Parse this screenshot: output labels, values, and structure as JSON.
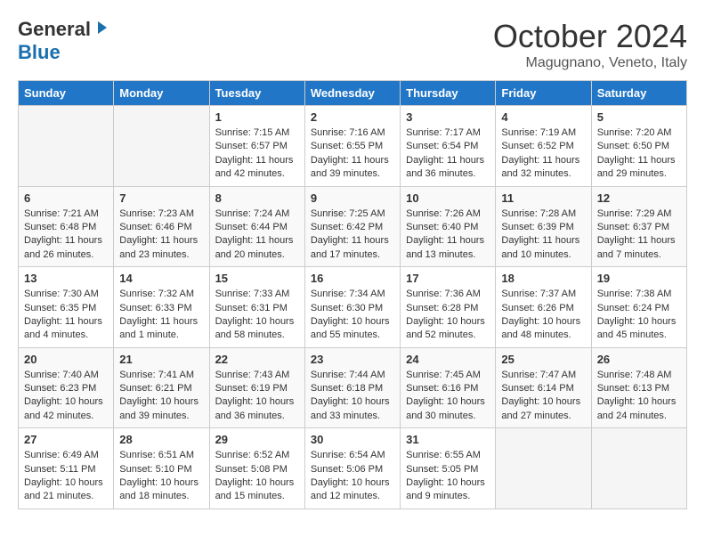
{
  "header": {
    "logo_general": "General",
    "logo_blue": "Blue",
    "month": "October 2024",
    "location": "Magugnano, Veneto, Italy"
  },
  "days_of_week": [
    "Sunday",
    "Monday",
    "Tuesday",
    "Wednesday",
    "Thursday",
    "Friday",
    "Saturday"
  ],
  "weeks": [
    [
      {
        "day": "",
        "empty": true
      },
      {
        "day": "",
        "empty": true
      },
      {
        "day": "1",
        "sunrise": "7:15 AM",
        "sunset": "6:57 PM",
        "daylight": "11 hours and 42 minutes."
      },
      {
        "day": "2",
        "sunrise": "7:16 AM",
        "sunset": "6:55 PM",
        "daylight": "11 hours and 39 minutes."
      },
      {
        "day": "3",
        "sunrise": "7:17 AM",
        "sunset": "6:54 PM",
        "daylight": "11 hours and 36 minutes."
      },
      {
        "day": "4",
        "sunrise": "7:19 AM",
        "sunset": "6:52 PM",
        "daylight": "11 hours and 32 minutes."
      },
      {
        "day": "5",
        "sunrise": "7:20 AM",
        "sunset": "6:50 PM",
        "daylight": "11 hours and 29 minutes."
      }
    ],
    [
      {
        "day": "6",
        "sunrise": "7:21 AM",
        "sunset": "6:48 PM",
        "daylight": "11 hours and 26 minutes."
      },
      {
        "day": "7",
        "sunrise": "7:23 AM",
        "sunset": "6:46 PM",
        "daylight": "11 hours and 23 minutes."
      },
      {
        "day": "8",
        "sunrise": "7:24 AM",
        "sunset": "6:44 PM",
        "daylight": "11 hours and 20 minutes."
      },
      {
        "day": "9",
        "sunrise": "7:25 AM",
        "sunset": "6:42 PM",
        "daylight": "11 hours and 17 minutes."
      },
      {
        "day": "10",
        "sunrise": "7:26 AM",
        "sunset": "6:40 PM",
        "daylight": "11 hours and 13 minutes."
      },
      {
        "day": "11",
        "sunrise": "7:28 AM",
        "sunset": "6:39 PM",
        "daylight": "11 hours and 10 minutes."
      },
      {
        "day": "12",
        "sunrise": "7:29 AM",
        "sunset": "6:37 PM",
        "daylight": "11 hours and 7 minutes."
      }
    ],
    [
      {
        "day": "13",
        "sunrise": "7:30 AM",
        "sunset": "6:35 PM",
        "daylight": "11 hours and 4 minutes."
      },
      {
        "day": "14",
        "sunrise": "7:32 AM",
        "sunset": "6:33 PM",
        "daylight": "11 hours and 1 minute."
      },
      {
        "day": "15",
        "sunrise": "7:33 AM",
        "sunset": "6:31 PM",
        "daylight": "10 hours and 58 minutes."
      },
      {
        "day": "16",
        "sunrise": "7:34 AM",
        "sunset": "6:30 PM",
        "daylight": "10 hours and 55 minutes."
      },
      {
        "day": "17",
        "sunrise": "7:36 AM",
        "sunset": "6:28 PM",
        "daylight": "10 hours and 52 minutes."
      },
      {
        "day": "18",
        "sunrise": "7:37 AM",
        "sunset": "6:26 PM",
        "daylight": "10 hours and 48 minutes."
      },
      {
        "day": "19",
        "sunrise": "7:38 AM",
        "sunset": "6:24 PM",
        "daylight": "10 hours and 45 minutes."
      }
    ],
    [
      {
        "day": "20",
        "sunrise": "7:40 AM",
        "sunset": "6:23 PM",
        "daylight": "10 hours and 42 minutes."
      },
      {
        "day": "21",
        "sunrise": "7:41 AM",
        "sunset": "6:21 PM",
        "daylight": "10 hours and 39 minutes."
      },
      {
        "day": "22",
        "sunrise": "7:43 AM",
        "sunset": "6:19 PM",
        "daylight": "10 hours and 36 minutes."
      },
      {
        "day": "23",
        "sunrise": "7:44 AM",
        "sunset": "6:18 PM",
        "daylight": "10 hours and 33 minutes."
      },
      {
        "day": "24",
        "sunrise": "7:45 AM",
        "sunset": "6:16 PM",
        "daylight": "10 hours and 30 minutes."
      },
      {
        "day": "25",
        "sunrise": "7:47 AM",
        "sunset": "6:14 PM",
        "daylight": "10 hours and 27 minutes."
      },
      {
        "day": "26",
        "sunrise": "7:48 AM",
        "sunset": "6:13 PM",
        "daylight": "10 hours and 24 minutes."
      }
    ],
    [
      {
        "day": "27",
        "sunrise": "6:49 AM",
        "sunset": "5:11 PM",
        "daylight": "10 hours and 21 minutes."
      },
      {
        "day": "28",
        "sunrise": "6:51 AM",
        "sunset": "5:10 PM",
        "daylight": "10 hours and 18 minutes."
      },
      {
        "day": "29",
        "sunrise": "6:52 AM",
        "sunset": "5:08 PM",
        "daylight": "10 hours and 15 minutes."
      },
      {
        "day": "30",
        "sunrise": "6:54 AM",
        "sunset": "5:06 PM",
        "daylight": "10 hours and 12 minutes."
      },
      {
        "day": "31",
        "sunrise": "6:55 AM",
        "sunset": "5:05 PM",
        "daylight": "10 hours and 9 minutes."
      },
      {
        "day": "",
        "empty": true
      },
      {
        "day": "",
        "empty": true
      }
    ]
  ]
}
